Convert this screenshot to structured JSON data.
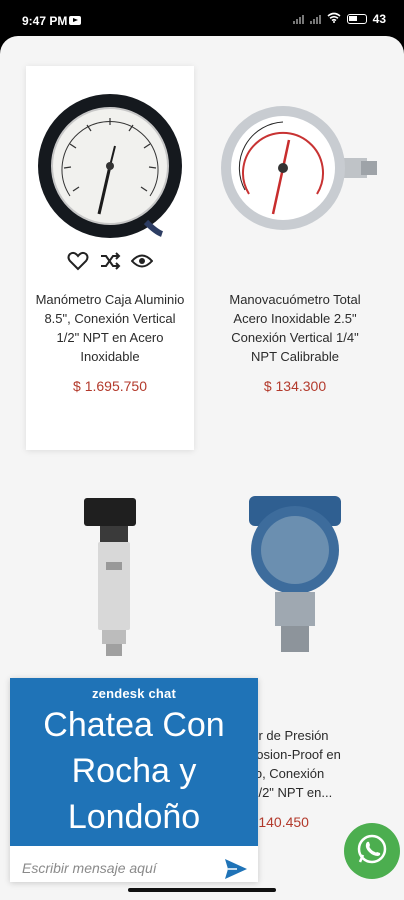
{
  "status_bar": {
    "time": "9:47 PM",
    "battery": "43"
  },
  "products": [
    {
      "name": "Manómetro Caja Aluminio 8.5\", Conexión Vertical 1/2\" NPT en Acero Inoxidable",
      "price": "$ 1.695.750"
    },
    {
      "name": "Manovacuómetro Total Acero Inoxidable 2.5\" Conexión Vertical 1/4\" NPT Calibrable",
      "price": "$ 134.300"
    },
    {
      "name": "",
      "price": ""
    },
    {
      "name": "misor de Presión\nExplosion-Proof en\nminio, Conexión\ncal 1/2\" NPT en...",
      "price": "$ 3.140.450"
    }
  ],
  "chat": {
    "brand": "zendesk chat",
    "title": "Chatea Con Rocha y Londoño",
    "placeholder": "Escribir mensaje aquí"
  },
  "icons": {
    "favorite": "heart-icon",
    "compare": "shuffle-icon",
    "quick_view": "eye-icon",
    "send": "send-icon",
    "whatsapp": "whatsapp-icon"
  },
  "colors": {
    "price": "#b33a2c",
    "chat_header": "#1f73b7",
    "whatsapp": "#4cae4f"
  }
}
